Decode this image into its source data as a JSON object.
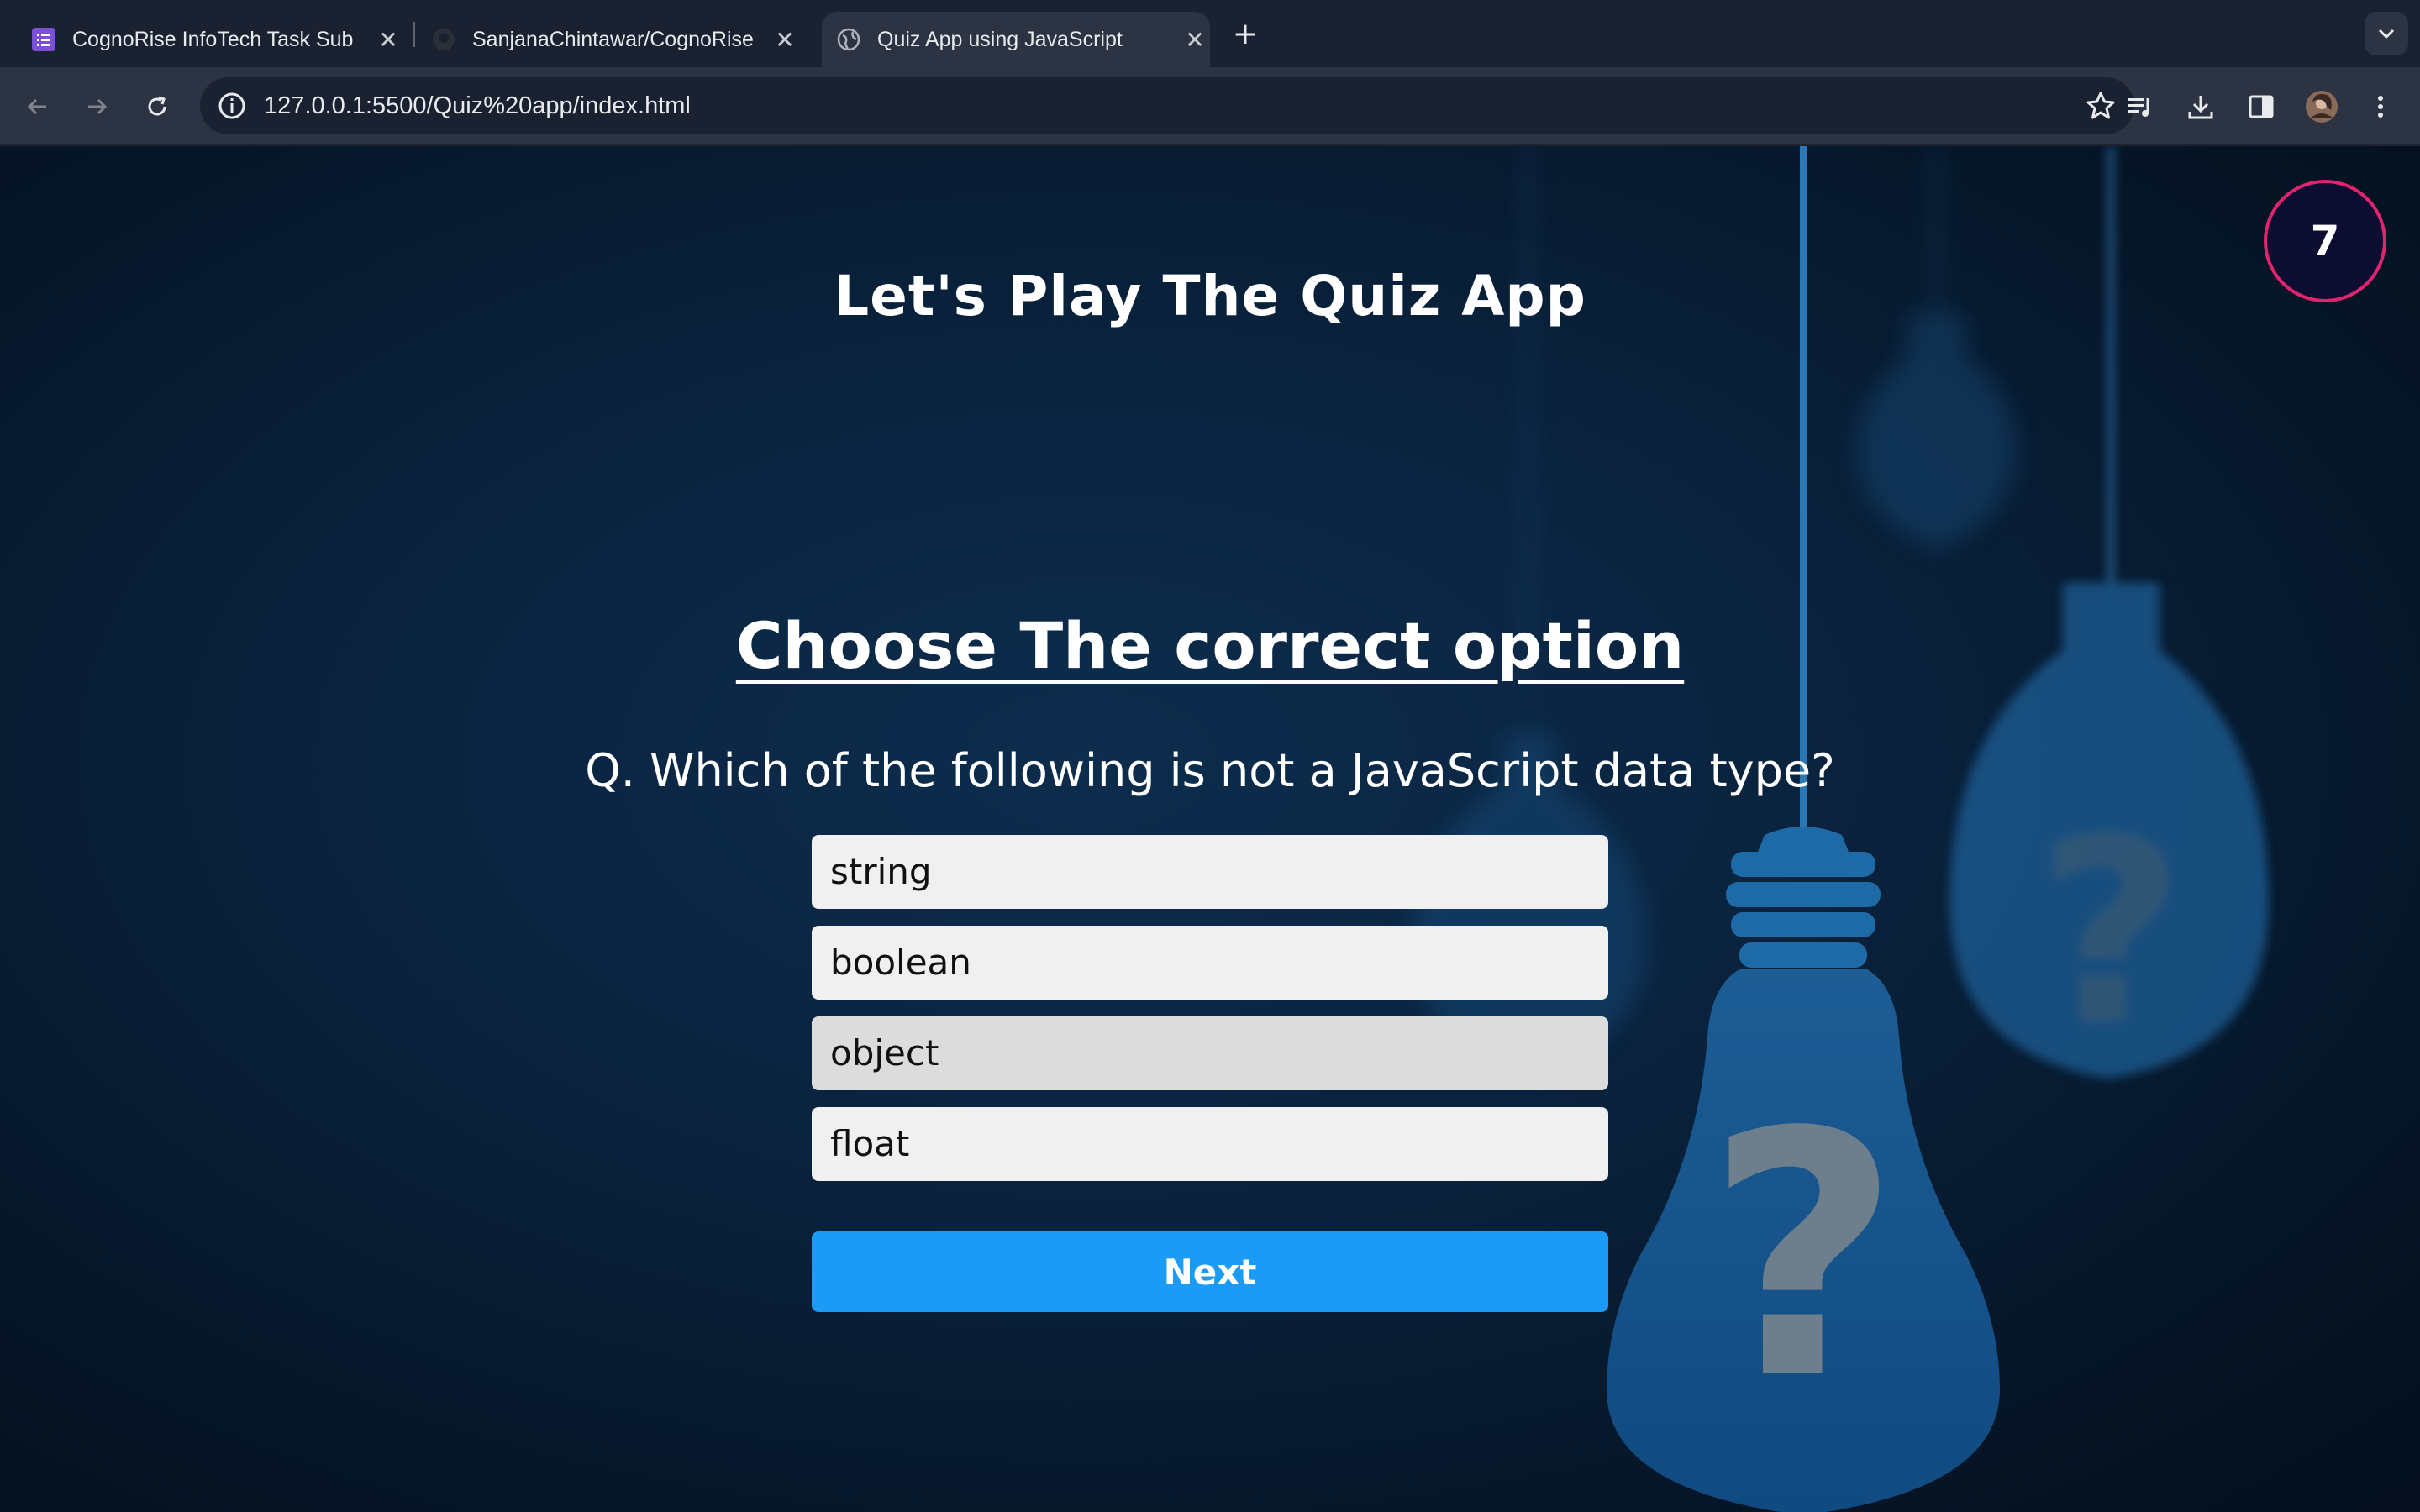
{
  "browser": {
    "tabs": [
      {
        "title": "CognoRise InfoTech Task Sub",
        "icon": "forms-icon",
        "active": false
      },
      {
        "title": "SanjanaChintawar/CognoRise",
        "icon": "github-icon",
        "active": false
      },
      {
        "title": "Quiz App using JavaScript",
        "icon": "globe-icon",
        "active": true
      }
    ],
    "url": "127.0.0.1:5500/Quiz%20app/index.html"
  },
  "quiz": {
    "timer": "7",
    "title": "Let's Play The Quiz App",
    "heading": "Choose The correct option",
    "question": "Q. Which of the following is not a JavaScript data type?",
    "options": [
      "string",
      "boolean",
      "object",
      "float"
    ],
    "hovered_option": "object",
    "next_label": "Next"
  },
  "colors": {
    "accent": "#1b9bf5",
    "timer_border": "#e0246e",
    "timer_fill": "#0c0d30",
    "option_bg": "#f0f0f0",
    "option_hover_bg": "#dcdcdc"
  }
}
